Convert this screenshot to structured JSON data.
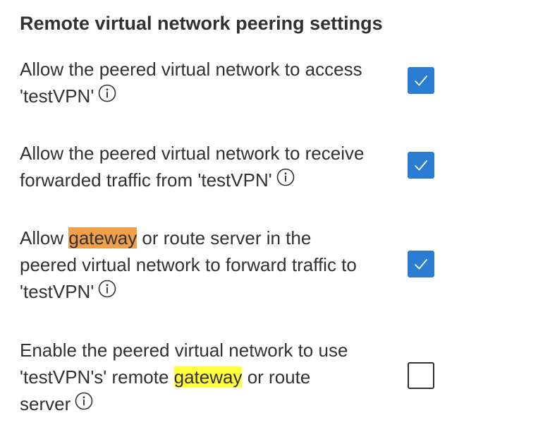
{
  "section": {
    "title": "Remote virtual network peering settings"
  },
  "settings": [
    {
      "label_line1": "Allow the peered virtual network to access",
      "label_line2": "'testVPN'",
      "checked": true
    },
    {
      "label_line1": "Allow the peered virtual network to receive",
      "label_line2": "forwarded traffic from 'testVPN'",
      "checked": true
    },
    {
      "label_pre": "Allow ",
      "label_highlight": "gateway",
      "label_post": " or route server in the",
      "label_line2": "peered virtual network to forward traffic to",
      "label_line3": "'testVPN'",
      "highlight_color": "#f0a04b",
      "checked": true
    },
    {
      "label_line1": "Enable the peered virtual network to use",
      "label_pre2": "'testVPN's' remote ",
      "label_highlight": "gateway",
      "label_post2": " or route",
      "label_line3": "server",
      "highlight_color": "#ffff3c",
      "checked": false
    }
  ],
  "colors": {
    "checkbox_checked": "#2b7cd3",
    "text": "#323130"
  },
  "icons": {
    "info": "info-icon",
    "check": "checkmark-icon"
  }
}
